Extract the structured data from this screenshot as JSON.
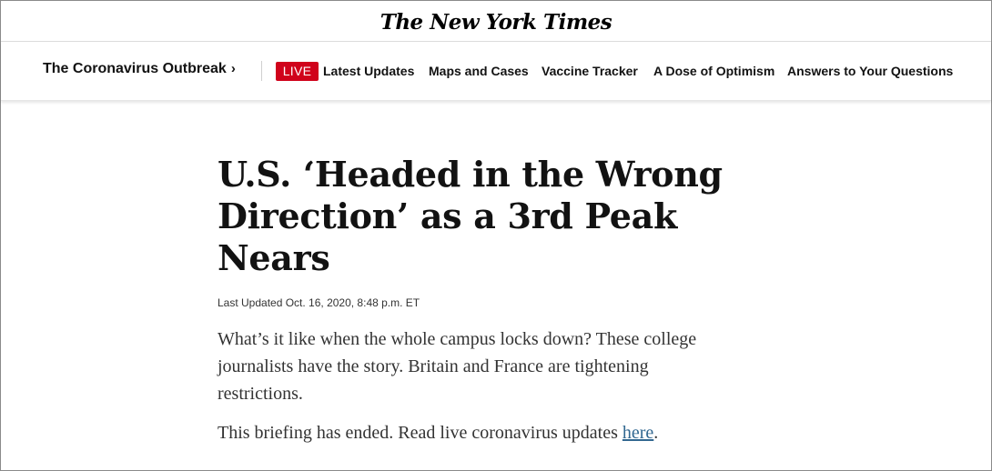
{
  "masthead": {
    "logo_text": "The New York Times"
  },
  "nav": {
    "section_title": "The Coronavirus Outbreak",
    "chevron": "›",
    "live_label": "LIVE",
    "links": [
      "Latest Updates",
      "Maps and Cases",
      "Vaccine Tracker",
      "A Dose of Optimism",
      "Answers to Your Questions"
    ]
  },
  "article": {
    "headline": "U.S. ‘Headed in the Wrong Direction’ as a 3rd Peak Nears",
    "timestamp": "Last Updated Oct. 16, 2020, 8:48 p.m. ET",
    "summary": "What’s it like when the whole campus locks down? These college journalists have the story. Britain and France are tightening restrictions.",
    "ended_text": "This briefing has ended. Read live coronavirus updates ",
    "ended_link": "here",
    "ended_period": "."
  },
  "colors": {
    "live_red": "#d0021b",
    "link_blue": "#326891"
  }
}
